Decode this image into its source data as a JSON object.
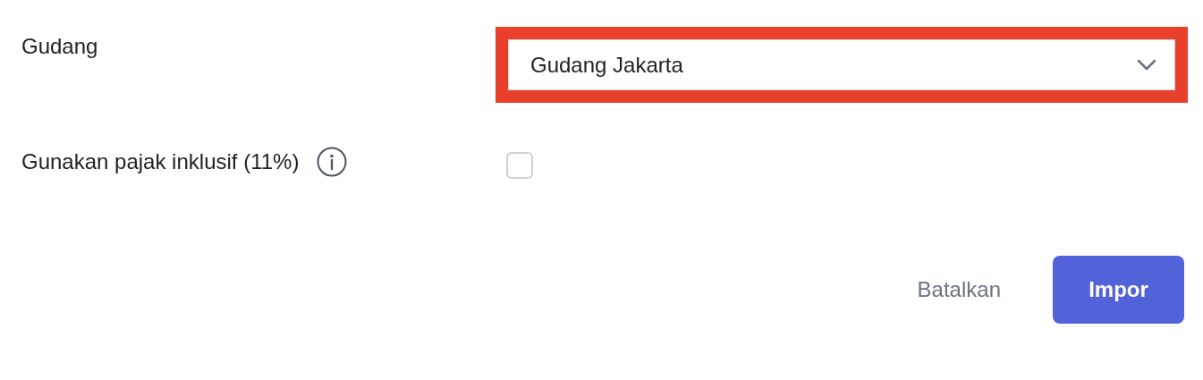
{
  "fields": [
    {
      "kind": "select",
      "label": "Gudang",
      "value": "Gudang Jakarta",
      "highlighted": true
    },
    {
      "kind": "checkbox",
      "label": "Gunakan pajak inklusif (11%)",
      "info": true,
      "checked": false
    }
  ],
  "buttons": [
    {
      "kind": "text",
      "label": "Batalkan"
    },
    {
      "kind": "primary",
      "label": "Impor"
    }
  ]
}
